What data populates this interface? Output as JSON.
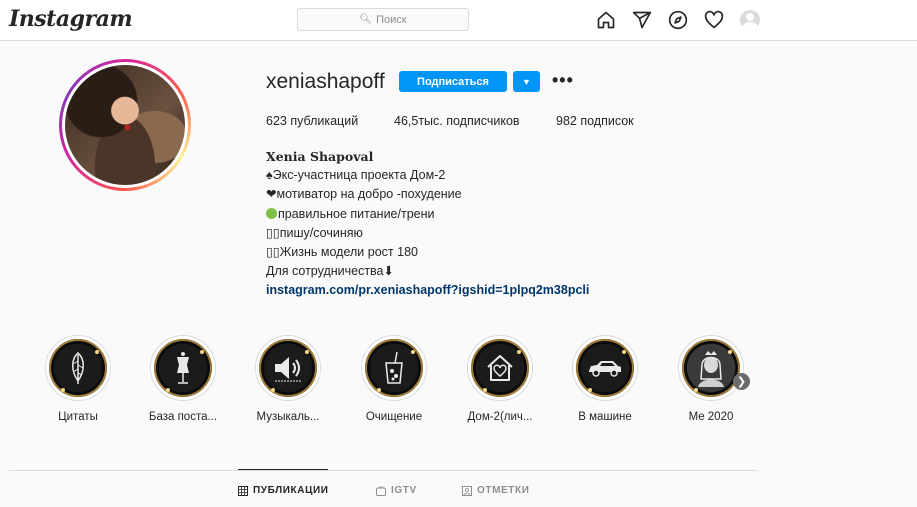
{
  "header": {
    "logo": "Instagram",
    "search_placeholder": "Поиск",
    "icons": [
      "home-icon",
      "send-icon",
      "explore-icon",
      "heart-icon",
      "profile-avatar"
    ]
  },
  "profile": {
    "username": "xeniashapoff",
    "follow_label": "Подписаться",
    "stats": {
      "posts": "623 публикаций",
      "followers_count": "46,5тыс.",
      "followers_label": " подписчиков",
      "following": "982 подписок"
    },
    "bio": {
      "name": "Xenia Shapoval",
      "lines": [
        "♠Экс-участница проекта Дом-2",
        "❤мотиватор на добро -похудение",
        "правильное питание/трени",
        "пишу/сочиняю",
        "Жизнь модели рост 180",
        "Для сотрудничества⬇"
      ],
      "link": "instagram.com/pr.xeniashapoff?igshid=1plpq2m38pcli"
    }
  },
  "highlights": [
    {
      "label": "Цитаты",
      "icon": "feather-icon"
    },
    {
      "label": "База поста...",
      "icon": "mannequin-icon"
    },
    {
      "label": "Музыкаль...",
      "icon": "speaker-icon"
    },
    {
      "label": "Очищение",
      "icon": "drink-icon"
    },
    {
      "label": "Дом-2(лич...",
      "icon": "house-heart-icon"
    },
    {
      "label": "В машине",
      "icon": "car-icon"
    },
    {
      "label": "Me 2020",
      "icon": "portrait-icon"
    }
  ],
  "tabs": [
    {
      "label": "ПУБЛИКАЦИИ",
      "icon": "grid-icon",
      "active": true
    },
    {
      "label": "IGTV",
      "icon": "igtv-icon",
      "active": false
    },
    {
      "label": "ОТМЕТКИ",
      "icon": "tag-icon",
      "active": false
    }
  ],
  "colors": {
    "accent": "#0095f6",
    "link": "#00376b",
    "background": "#fafafa"
  }
}
